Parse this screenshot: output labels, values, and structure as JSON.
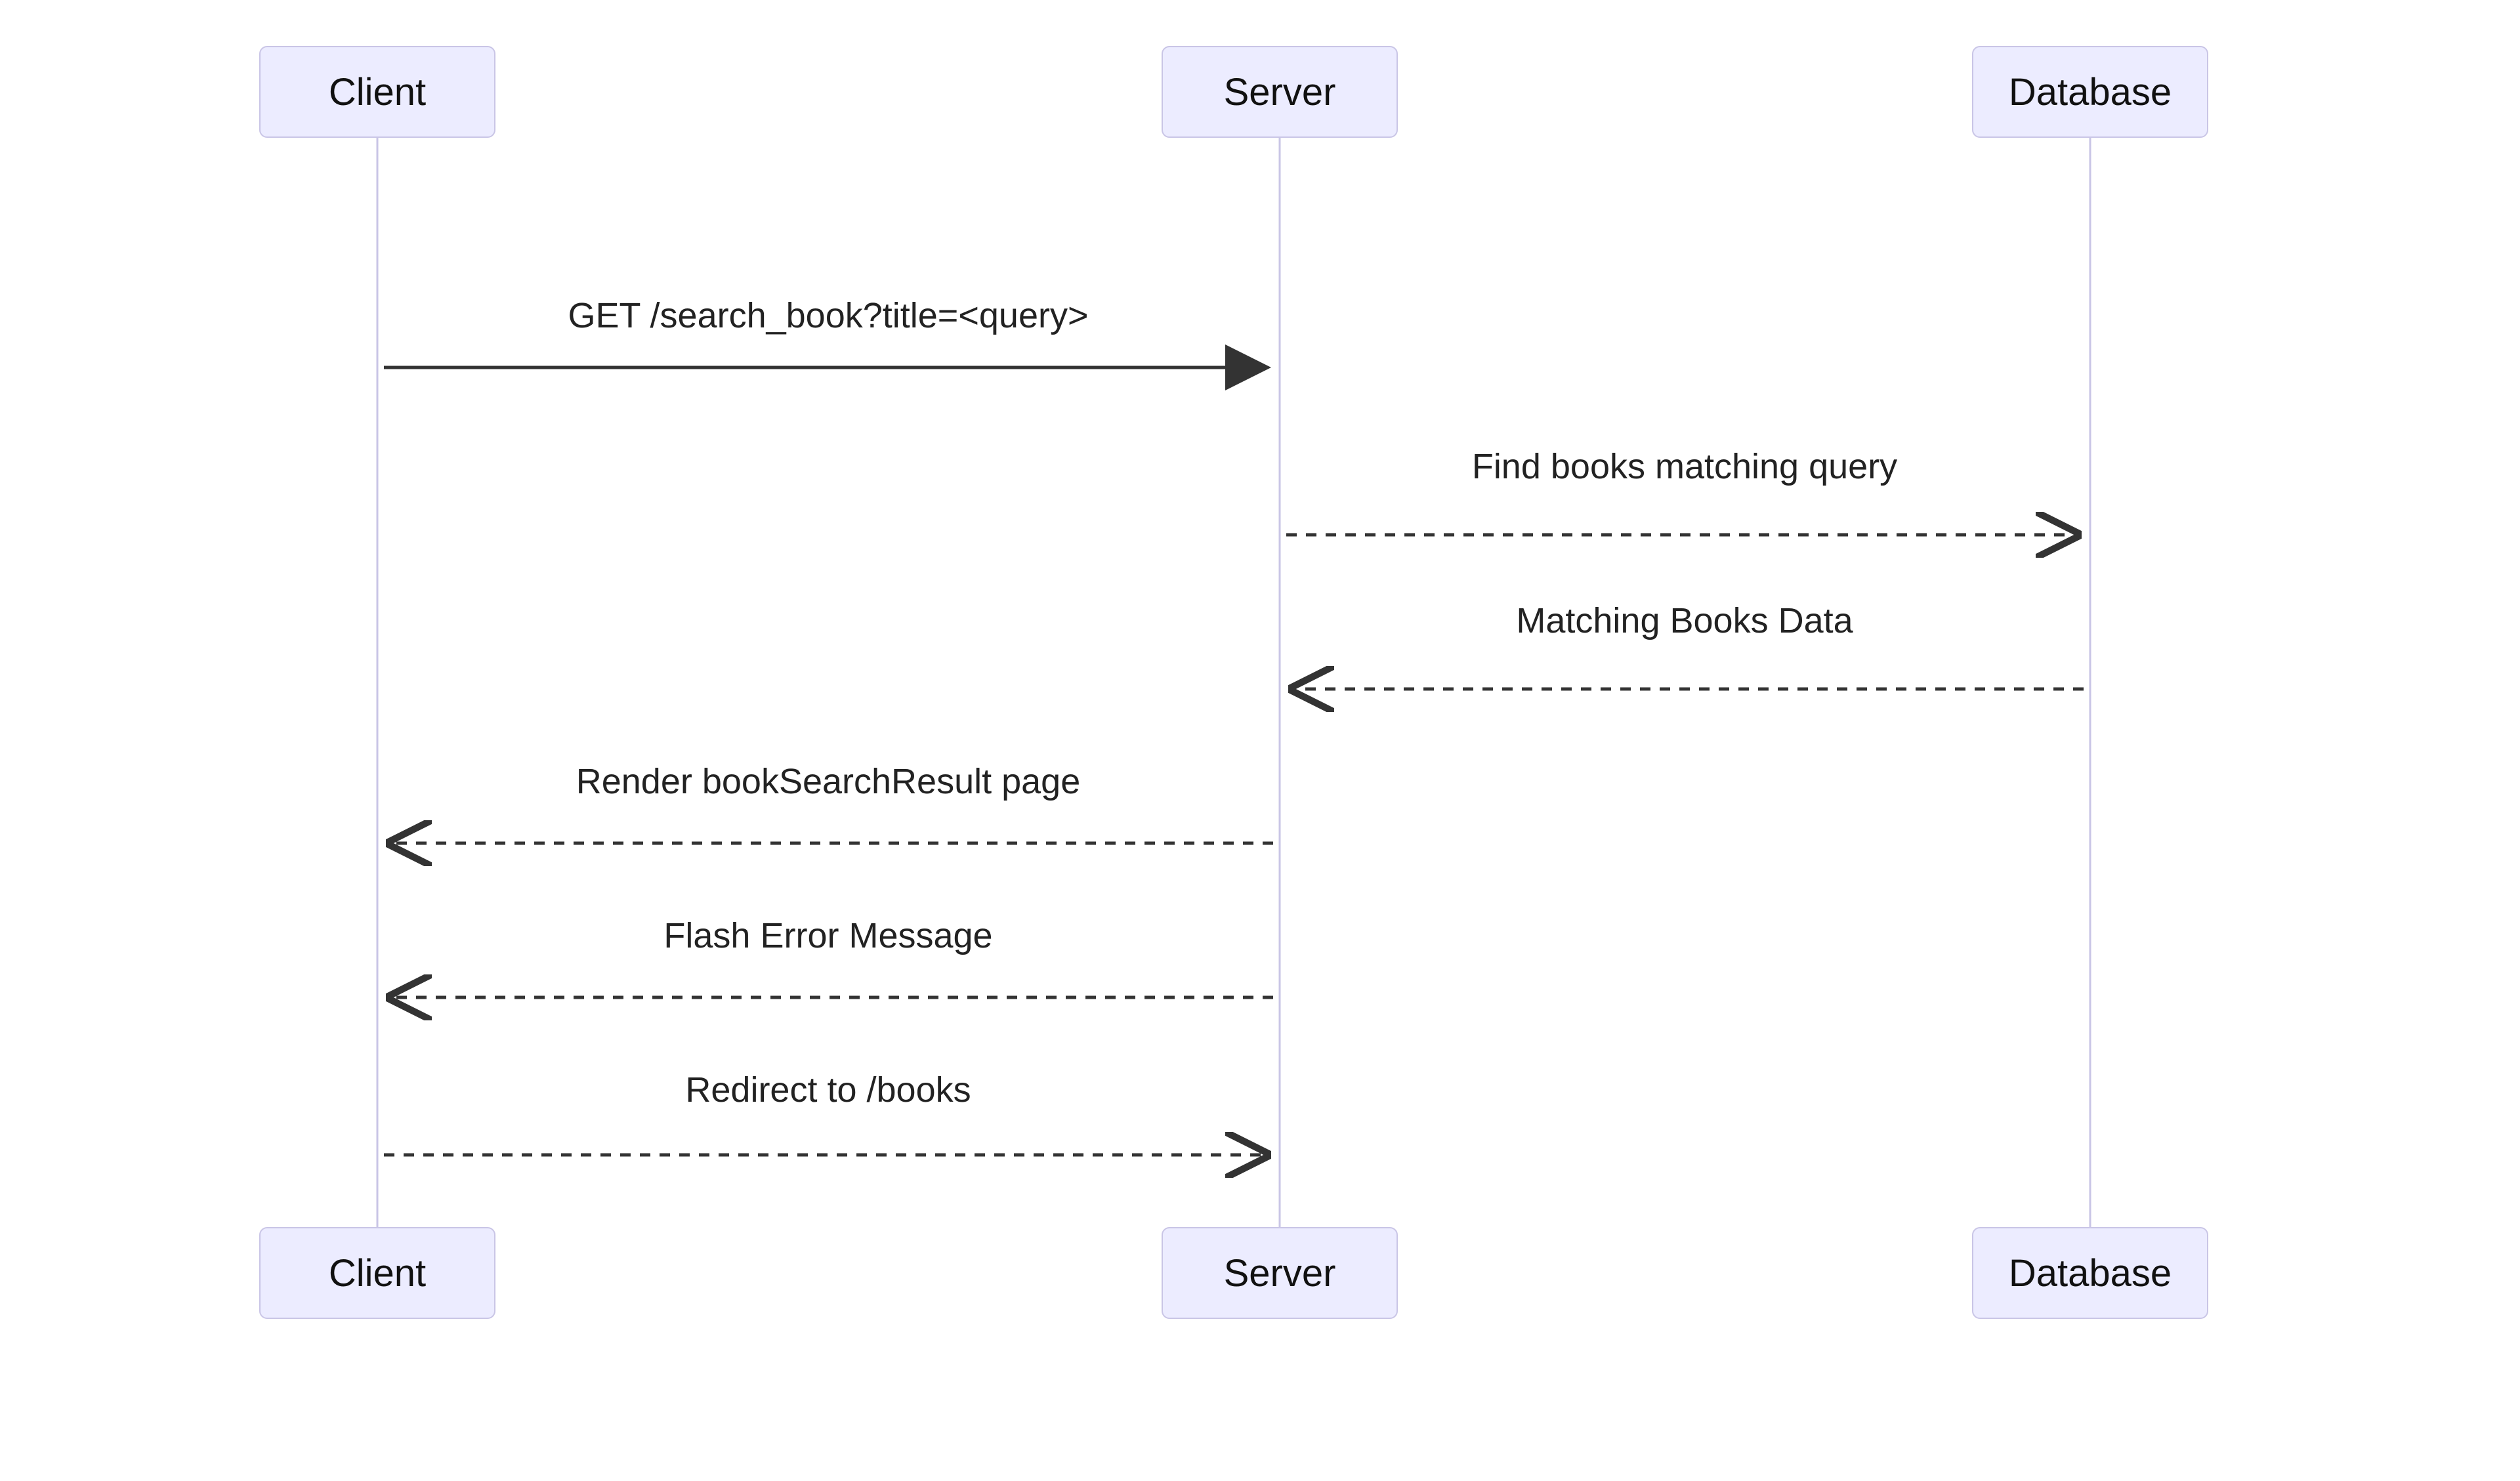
{
  "participants": {
    "client": "Client",
    "server": "Server",
    "database": "Database"
  },
  "messages": {
    "m1": {
      "text": "GET /search_book?title=<query>",
      "from": "client",
      "to": "server",
      "style": "solid"
    },
    "m2": {
      "text": "Find books matching query",
      "from": "server",
      "to": "database",
      "style": "dashed"
    },
    "m3": {
      "text": "Matching Books Data",
      "from": "database",
      "to": "server",
      "style": "dashed"
    },
    "m4": {
      "text": "Render bookSearchResult page",
      "from": "server",
      "to": "client",
      "style": "dashed"
    },
    "m5": {
      "text": "Flash Error Message",
      "from": "server",
      "to": "client",
      "style": "dashed"
    },
    "m6": {
      "text": "Redirect to /books",
      "from": "client",
      "to": "server",
      "style": "dashed"
    }
  },
  "diagram_type": "sequence"
}
